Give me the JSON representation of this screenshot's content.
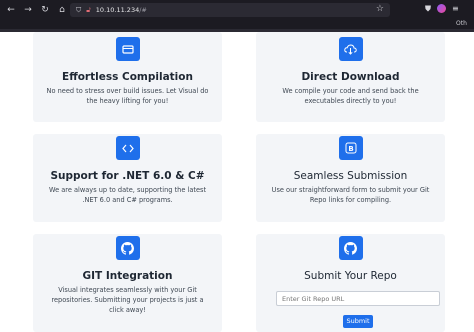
{
  "browser": {
    "url_host": "10.10.11.234",
    "url_path": "/#",
    "bookmarks_label": "Oth"
  },
  "cards": [
    {
      "title": "Effortless Compilation",
      "desc": "No need to stress over build issues. Let Visual do the heavy lifting for you!",
      "icon": "box-icon"
    },
    {
      "title": "Direct Download",
      "desc": "We compile your code and send back the executables directly to you!",
      "icon": "cloud-download-icon"
    },
    {
      "title": "Support for .NET 6.0 & C#",
      "desc": "We are always up to date, supporting the latest .NET 6.0 and C# programs.",
      "icon": "code-icon"
    },
    {
      "title": "Seamless Submission",
      "desc": "Use our straightforward form to submit your Git Repo links for compiling.",
      "icon": "bootstrap-icon"
    },
    {
      "title": "GIT Integration",
      "desc": "Visual integrates seamlessly with your Git repositories. Submitting your projects is just a click away!",
      "icon": "github-icon"
    },
    {
      "title": "Submit Your Repo",
      "icon": "github-icon"
    }
  ],
  "repo_form": {
    "placeholder": "Enter Git Repo URL",
    "submit_label": "Submit"
  },
  "colors": {
    "accent": "#1f6feb",
    "card_bg": "#f3f5f8",
    "browser_bg": "#1c1b22"
  }
}
